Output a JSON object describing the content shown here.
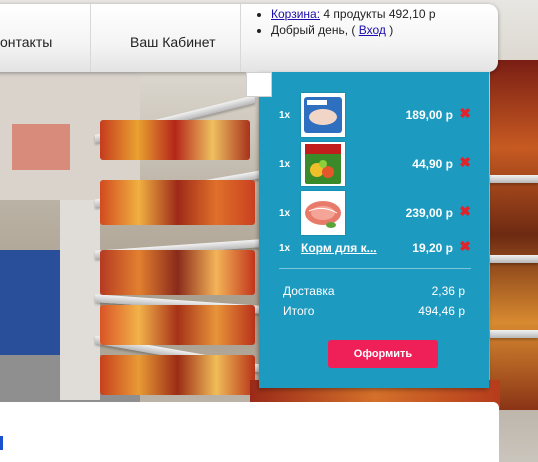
{
  "nav": {
    "items": [
      {
        "label": "онтакты"
      },
      {
        "label": "Ваш Кабинет"
      }
    ]
  },
  "user_box": {
    "cart_link": "Корзина:",
    "cart_summary": "4 продукты 492,10 р",
    "greeting": "Добрый день, (",
    "login_link": "Вход",
    "greeting_close": ")"
  },
  "cart": {
    "items": [
      {
        "qty": "1x",
        "price": "189,00 р",
        "icon": "fish-fillet-package-thumb"
      },
      {
        "qty": "1x",
        "price": "44,90 р",
        "icon": "vegetable-mix-package-thumb"
      },
      {
        "qty": "1x",
        "price": "239,00 р",
        "icon": "salmon-steak-thumb"
      },
      {
        "qty": "1x",
        "name": "Корм для к...",
        "price": "19,20 р"
      }
    ],
    "delivery_label": "Доставка",
    "delivery_value": "2,36 р",
    "total_label": "Итого",
    "total_value": "494,46 р",
    "checkout_label": "Оформить",
    "colors": {
      "panel": "#1c9ac0",
      "button": "#ef1f57",
      "remove": "#e0242b"
    }
  }
}
